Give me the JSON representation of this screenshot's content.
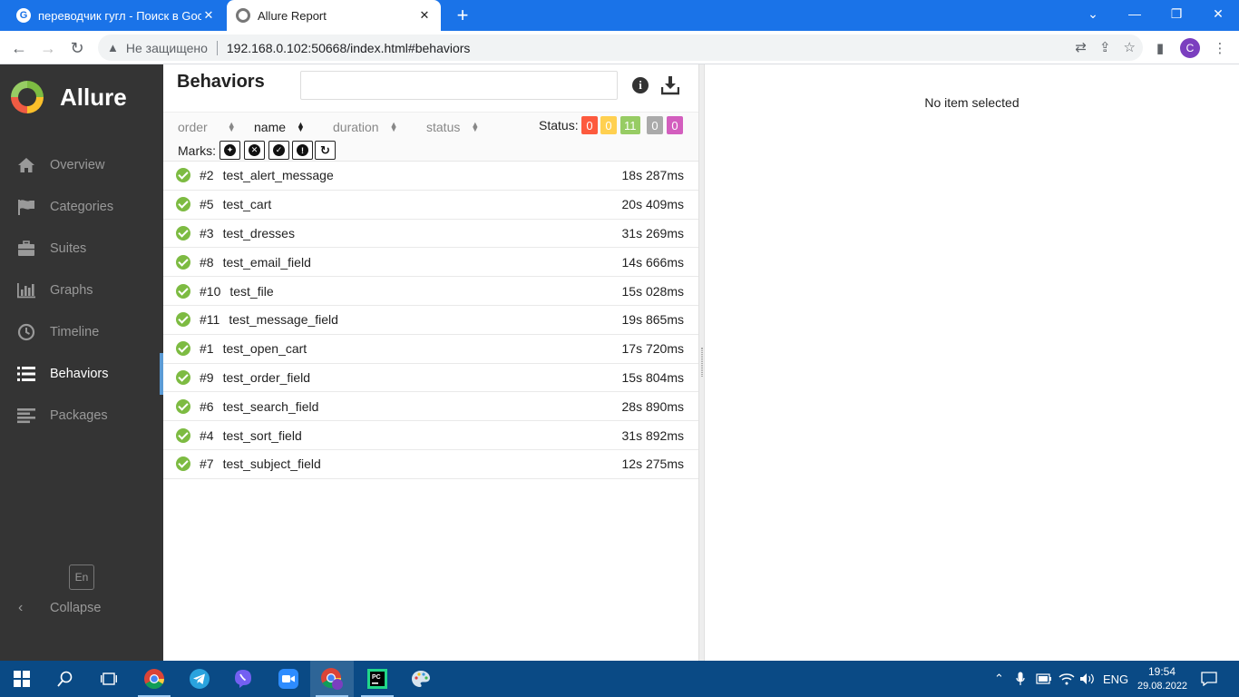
{
  "browser": {
    "tabs": [
      {
        "title": "переводчик гугл - Поиск в Goo",
        "icon": "google-g-icon",
        "active": false
      },
      {
        "title": "Allure Report",
        "icon": "allure-icon",
        "active": true
      }
    ],
    "security_label": "Не защищено",
    "url": "192.168.0.102:50668/index.html#behaviors",
    "profile_initial": "C"
  },
  "sidebar": {
    "brand": "Allure",
    "items": [
      {
        "label": "Overview",
        "icon": "home-icon",
        "active": false
      },
      {
        "label": "Categories",
        "icon": "flag-icon",
        "active": false
      },
      {
        "label": "Suites",
        "icon": "briefcase-icon",
        "active": false
      },
      {
        "label": "Graphs",
        "icon": "bar-chart-icon",
        "active": false
      },
      {
        "label": "Timeline",
        "icon": "clock-icon",
        "active": false
      },
      {
        "label": "Behaviors",
        "icon": "list-icon",
        "active": true
      },
      {
        "label": "Packages",
        "icon": "align-left-icon",
        "active": false
      }
    ],
    "language": "En",
    "collapse_label": "Collapse"
  },
  "behaviors": {
    "title": "Behaviors",
    "filter_placeholder": "",
    "sorters": [
      {
        "label": "order",
        "active": false
      },
      {
        "label": "name",
        "active": true
      },
      {
        "label": "duration",
        "active": false
      },
      {
        "label": "status",
        "active": false
      }
    ],
    "status_label": "Status:",
    "statuses": [
      {
        "name": "failed",
        "count": "0",
        "color": "#fd5a3e"
      },
      {
        "name": "broken",
        "count": "0",
        "color": "#ffd050"
      },
      {
        "name": "passed",
        "count": "11",
        "color": "#97cc64"
      },
      {
        "name": "skipped",
        "count": "0",
        "color": "#aaaaaa"
      },
      {
        "name": "unknown",
        "count": "0",
        "color": "#d35ebe"
      }
    ],
    "marks_label": "Marks:",
    "marks": [
      "bomb-icon",
      "times-circle-icon",
      "check-circle-icon",
      "exclamation-icon",
      "refresh-icon"
    ],
    "rows": [
      {
        "uid": "#2",
        "name": "test_alert_message",
        "duration": "18s 287ms",
        "status": "passed"
      },
      {
        "uid": "#5",
        "name": "test_cart",
        "duration": "20s 409ms",
        "status": "passed"
      },
      {
        "uid": "#3",
        "name": "test_dresses",
        "duration": "31s 269ms",
        "status": "passed"
      },
      {
        "uid": "#8",
        "name": "test_email_field",
        "duration": "14s 666ms",
        "status": "passed"
      },
      {
        "uid": "#10",
        "name": "test_file",
        "duration": "15s 028ms",
        "status": "passed"
      },
      {
        "uid": "#11",
        "name": "test_message_field",
        "duration": "19s 865ms",
        "status": "passed"
      },
      {
        "uid": "#1",
        "name": "test_open_cart",
        "duration": "17s 720ms",
        "status": "passed"
      },
      {
        "uid": "#9",
        "name": "test_order_field",
        "duration": "15s 804ms",
        "status": "passed"
      },
      {
        "uid": "#6",
        "name": "test_search_field",
        "duration": "28s 890ms",
        "status": "passed"
      },
      {
        "uid": "#4",
        "name": "test_sort_field",
        "duration": "31s 892ms",
        "status": "passed"
      },
      {
        "uid": "#7",
        "name": "test_subject_field",
        "duration": "12s 275ms",
        "status": "passed"
      }
    ]
  },
  "detail": {
    "empty_text": "No item selected"
  },
  "taskbar": {
    "language": "ENG",
    "time": "19:54",
    "date": "29.08.2022"
  }
}
